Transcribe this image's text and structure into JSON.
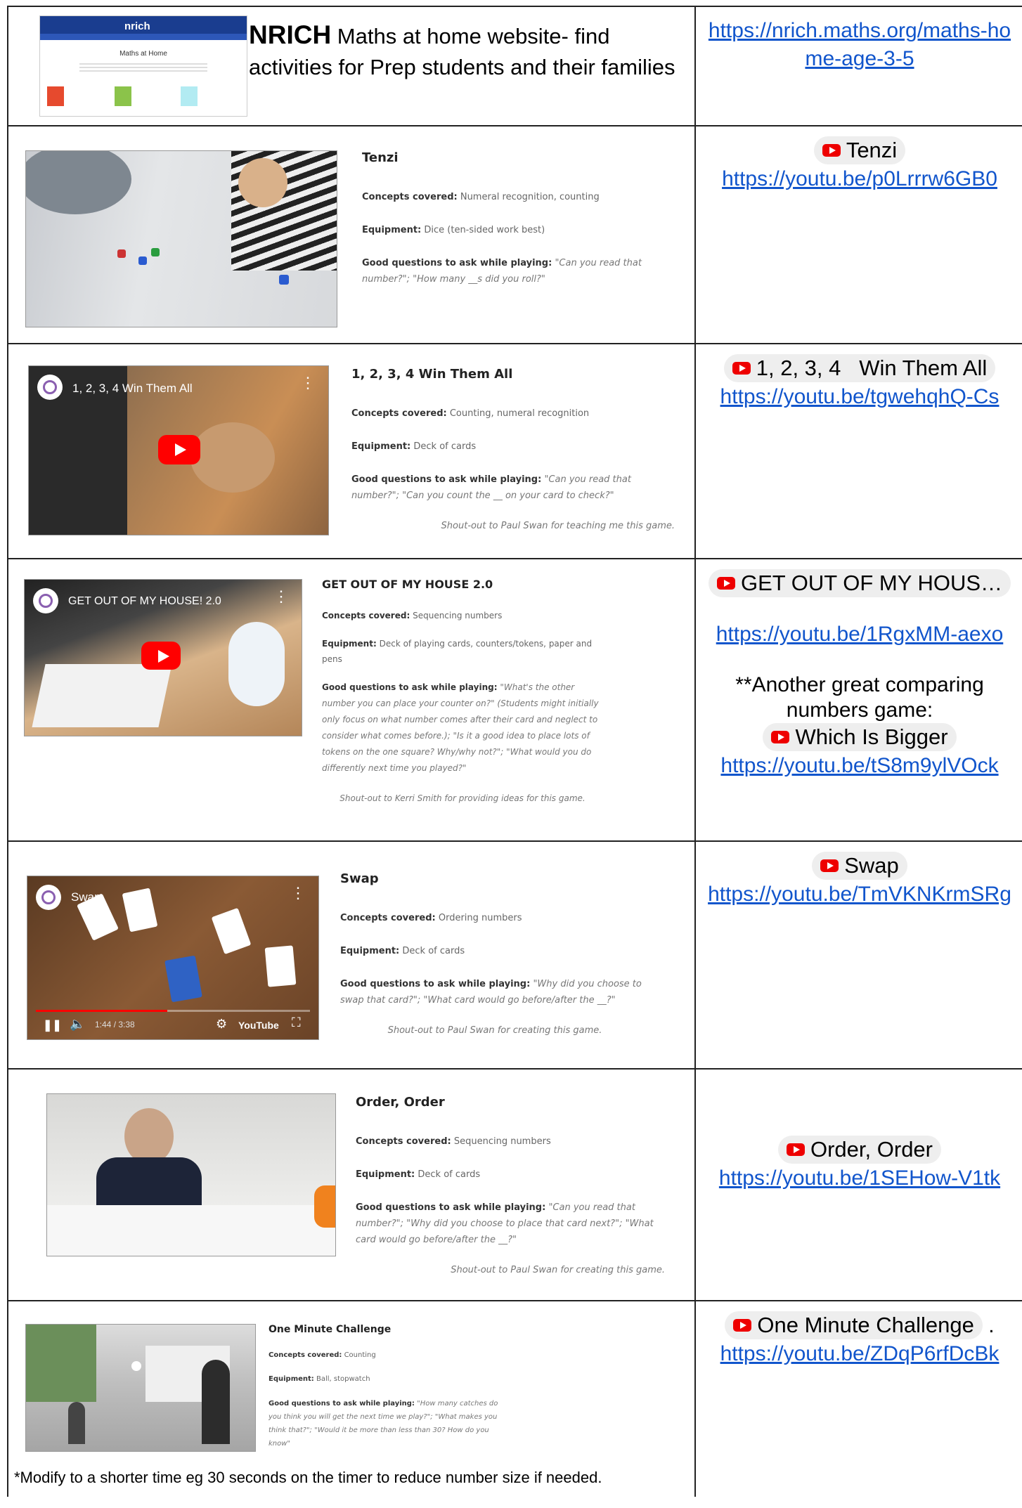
{
  "nrich": {
    "brand": "nrich",
    "heading": "Maths at Home",
    "title_bold": "NRICH",
    "title_rest": " Maths at home website- find activities for Prep students and their families",
    "link": "https://nrich.maths.org/maths-home-age-3-5"
  },
  "games": [
    {
      "title": "Tenzi",
      "concepts": "Numeral recognition, counting",
      "equipment": "Dice (ten-sided work best)",
      "questions": "\"Can you read that number?\";  \"How many __s did you roll?\"",
      "shoutout": "",
      "chip": "Tenzi",
      "link": "https://youtu.be/p0Lrrrw6GB0"
    },
    {
      "title": "1, 2, 3, 4 Win Them All",
      "video_title": "1, 2, 3, 4 Win Them All",
      "concepts": "Counting, numeral recognition",
      "equipment": "Deck of cards",
      "questions": "\"Can you read that number?\";  \"Can you count the __ on your card to check?\"",
      "shoutout": "Shout-out to Paul Swan for teaching me this game.",
      "chip": "1, 2, 3, 4   Win Them All",
      "link": "https://youtu.be/tgwehqhQ-Cs"
    },
    {
      "title": "GET OUT OF MY HOUSE 2.0",
      "video_title": "GET OUT OF MY HOUSE! 2.0",
      "concepts": "Sequencing numbers",
      "equipment": "Deck of playing cards, counters/tokens, paper and pens",
      "questions": "\"What's the other number you can place your counter on?\" (Students might initially only focus on what number comes after their card and neglect to consider what comes before.);  \"Is it a good idea to place lots of tokens on the one square?  Why/why not?\";  \"What would you do differently next time you played?\"",
      "shoutout": "Shout-out to Kerri Smith for providing ideas for this game.",
      "chip": "GET OUT OF MY HOUS…",
      "link": "https://youtu.be/1RgxMM-aexo",
      "note": "**Another great comparing numbers game:",
      "chip2": "Which Is Bigger",
      "link2": "https://youtu.be/tS8m9ylVOck"
    },
    {
      "title": "Swap",
      "video_title": "Swap",
      "video_time": "1:44 / 3:38",
      "video_brand": "YouTube",
      "concepts": "Ordering numbers",
      "equipment": "Deck of cards",
      "questions": "\"Why did you choose to swap that card?\";  \"What card would go before/after the __?\"",
      "shoutout": "Shout-out to Paul Swan for creating this game.",
      "chip": "Swap",
      "link": "https://youtu.be/TmVKNKrmSRg"
    },
    {
      "title": "Order, Order",
      "concepts": "Sequencing numbers",
      "equipment": "Deck of cards",
      "questions": "\"Can you read that number?\";  \"Why did you choose to place that card next?\";  \"What card would go before/after the __?\"",
      "shoutout": "Shout-out to Paul Swan for creating this game.",
      "chip": "Order, Order",
      "link": "https://youtu.be/1SEHow-V1tk"
    },
    {
      "title": "One Minute Challenge",
      "concepts": "Counting",
      "equipment": "Ball, stopwatch",
      "questions": "\"How many catches do you think you will get the next time we play?\";  \"What makes you think that?\";  \"Would it be more than less than 30?  How do you know\"",
      "shoutout": "",
      "chip": "One Minute Challenge",
      "link": "https://youtu.be/ZDqP6rfDcBk",
      "footnote": "*Modify to a shorter time eg 30 seconds on the timer to reduce number size if needed."
    }
  ],
  "labels": {
    "concepts": "Concepts covered:",
    "equipment": "Equipment:",
    "questions": "Good questions to ask while playing:"
  },
  "colors": {
    "link": "#1155cc",
    "youtube_red": "#ff0000",
    "chip_bg": "#eeeeee"
  }
}
